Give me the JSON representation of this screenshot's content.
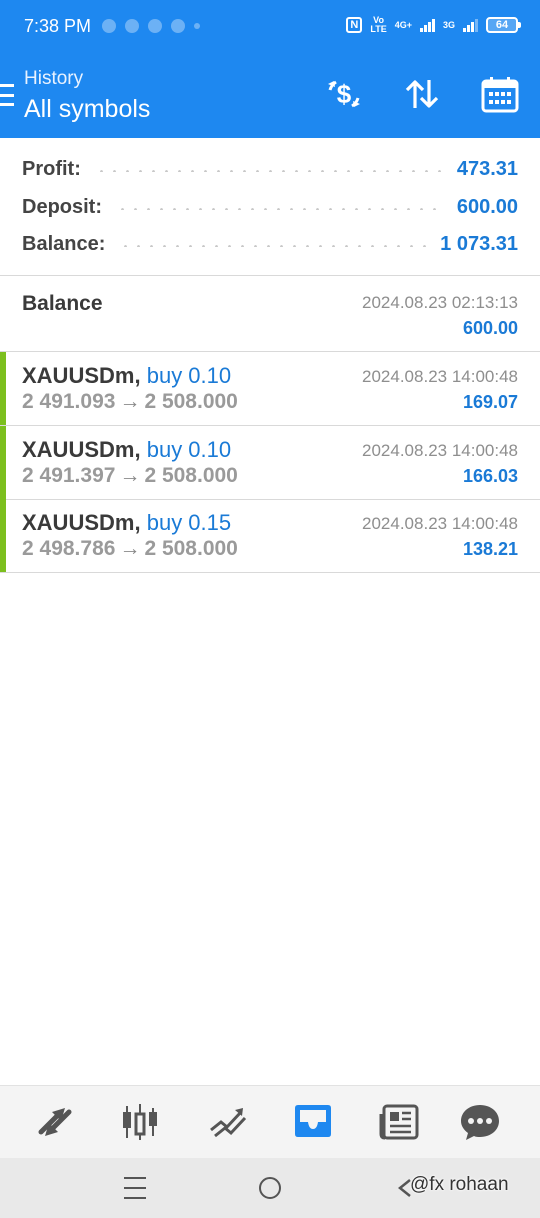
{
  "status_bar": {
    "time": "7:38 PM",
    "network_1": "4G+",
    "network_2": "3G",
    "volte_top": "Vo",
    "volte_bottom": "LTE",
    "nfc": "N",
    "battery": "64"
  },
  "header": {
    "subtitle": "History",
    "title": "All symbols",
    "icons": [
      "menu-icon",
      "dollar-exchange-icon",
      "sort-icon",
      "calendar-icon"
    ]
  },
  "summary": {
    "profit_label": "Profit:",
    "profit_value": "473.31",
    "deposit_label": "Deposit:",
    "deposit_value": "600.00",
    "balance_label": "Balance:",
    "balance_value": "1 073.31"
  },
  "balance_entry": {
    "title": "Balance",
    "time": "2024.08.23 02:13:13",
    "amount": "600.00"
  },
  "trades": [
    {
      "symbol": "XAUUSDm",
      "comma": ",",
      "type": "buy 0.10",
      "open_price": "2 491.093",
      "arrow": "→",
      "close_price": "2 508.000",
      "time": "2024.08.23 14:00:48",
      "profit": "169.07"
    },
    {
      "symbol": "XAUUSDm",
      "comma": ",",
      "type": "buy 0.10",
      "open_price": "2 491.397",
      "arrow": "→",
      "close_price": "2 508.000",
      "time": "2024.08.23 14:00:48",
      "profit": "166.03"
    },
    {
      "symbol": "XAUUSDm",
      "comma": ",",
      "type": "buy 0.15",
      "open_price": "2 498.786",
      "arrow": "→",
      "close_price": "2 508.000",
      "time": "2024.08.23 14:00:48",
      "profit": "138.21"
    }
  ],
  "tabbar": {
    "tabs": [
      "quotes-icon",
      "chart-icon",
      "trade-icon",
      "history-icon",
      "news-icon",
      "messages-icon"
    ],
    "active": "history-icon"
  },
  "watermark": "@fx rohaan",
  "colors": {
    "header_bg": "#1e88f0",
    "accent_blue": "#1a7ad6",
    "buy_marker": "#7cbf1e"
  }
}
